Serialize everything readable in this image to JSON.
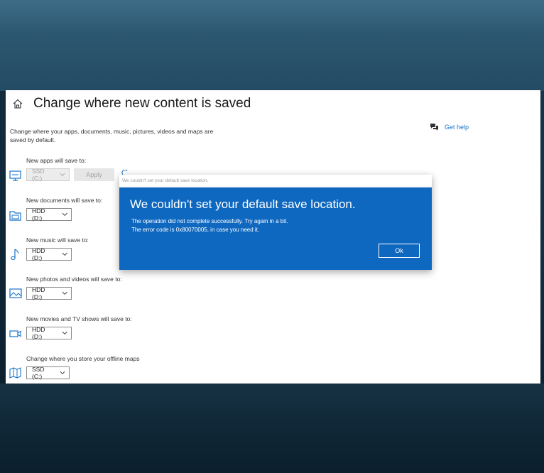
{
  "page": {
    "title": "Change where new content is saved",
    "description": "Change where your apps, documents, music, pictures, videos and maps are saved by default.",
    "help_link": "Get help"
  },
  "settings": [
    {
      "label": "New apps will save to:",
      "value": "SSD (C:)",
      "icon": "monitor-icon",
      "disabled": true,
      "apply_label": "Apply"
    },
    {
      "label": "New documents will save to:",
      "value": "HDD (D:)",
      "icon": "folder-icon"
    },
    {
      "label": "New music will save to:",
      "value": "HDD (D:)",
      "icon": "music-note-icon"
    },
    {
      "label": "New photos and videos will save to:",
      "value": "HDD (D:)",
      "icon": "image-icon"
    },
    {
      "label": "New movies and TV shows will save to:",
      "value": "HDD (D:)",
      "icon": "video-camera-icon"
    },
    {
      "label": "Change where you store your offline maps",
      "value": "SSD (C:)",
      "icon": "map-icon"
    }
  ],
  "dialog": {
    "window_title": "We couldn't set your default save location.",
    "heading": "We couldn't set your default save location.",
    "line1": "The operation did not complete successfully. Try again in a bit.",
    "line2": "The error code is 0x80070005, in case you need it.",
    "ok_label": "Ok"
  },
  "colors": {
    "accent": "#0f68c0",
    "link": "#1a73c8",
    "icon": "#1a73c8"
  }
}
